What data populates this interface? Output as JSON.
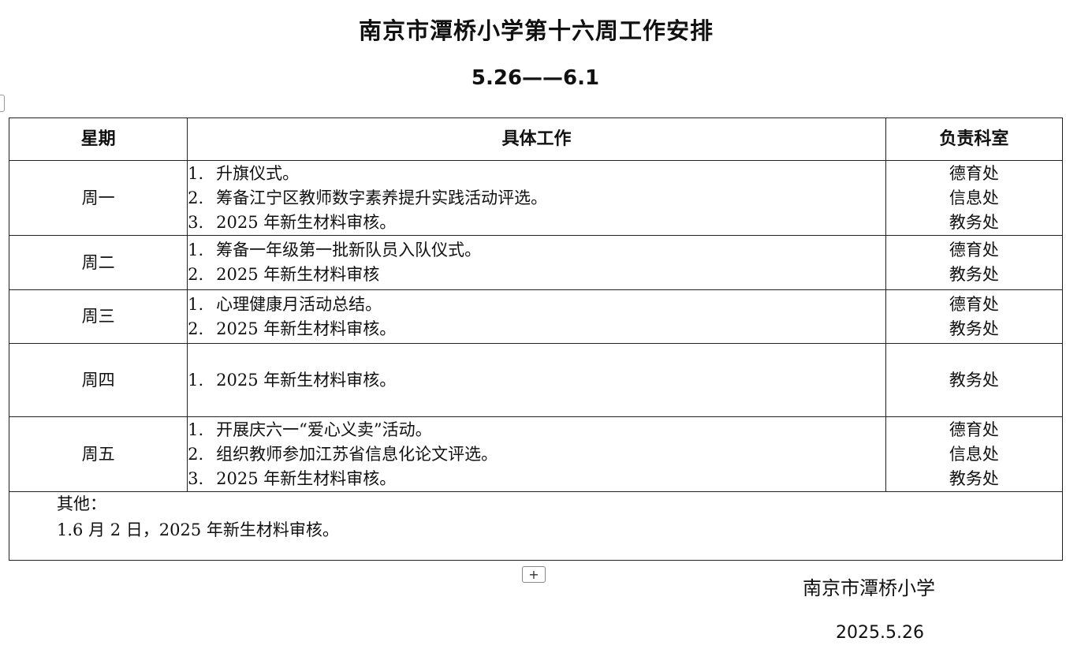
{
  "document": {
    "title": "南京市潭桥小学第十六周工作安排",
    "subtitle": "5.26——6.1"
  },
  "table": {
    "headers": {
      "day": "星期",
      "work": "具体工作",
      "dept": "负责科室"
    },
    "rows": [
      {
        "day": "周一",
        "items": [
          {
            "num": "1.",
            "text": "升旗仪式。"
          },
          {
            "num": "2.",
            "text": "筹备江宁区教师数字素养提升实践活动评选。"
          },
          {
            "num": "3.",
            "text": "2025 年新生材料审核。"
          }
        ],
        "depts": [
          "德育处",
          "信息处",
          "教务处"
        ]
      },
      {
        "day": "周二",
        "items": [
          {
            "num": "1.",
            "text": "筹备一年级第一批新队员入队仪式。"
          },
          {
            "num": "2.",
            "text": "2025 年新生材料审核"
          }
        ],
        "depts": [
          "德育处",
          "教务处"
        ]
      },
      {
        "day": "周三",
        "items": [
          {
            "num": "1.",
            "text": "心理健康月活动总结。"
          },
          {
            "num": "2.",
            "text": "2025 年新生材料审核。"
          }
        ],
        "depts": [
          "德育处",
          "教务处"
        ]
      },
      {
        "day": "周四",
        "items": [
          {
            "num": "1.",
            "text": "2025 年新生材料审核。"
          }
        ],
        "depts": [
          "教务处"
        ]
      },
      {
        "day": "周五",
        "items": [
          {
            "num": "1.",
            "text": "开展庆六一“爱心义卖”活动。"
          },
          {
            "num": "2.",
            "text": "组织教师参加江苏省信息化论文评选。"
          },
          {
            "num": "3.",
            "text": "2025 年新生材料审核。"
          }
        ],
        "depts": [
          "德育处",
          "信息处",
          "教务处"
        ]
      }
    ],
    "other": {
      "label": "其他：",
      "item": "1.6 月 2 日，2025 年新生材料审核。"
    }
  },
  "controls": {
    "add_row": "+"
  },
  "footer": {
    "org": "南京市潭桥小学",
    "date": "2025.5.26"
  }
}
